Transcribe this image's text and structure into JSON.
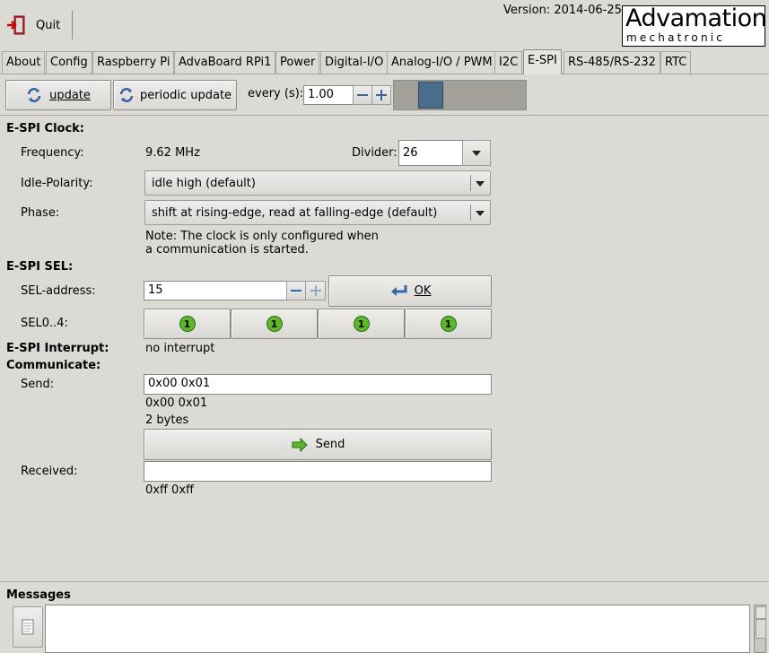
{
  "toolbar": {
    "quit_label": "Quit",
    "version": "Version: 2014-06-25"
  },
  "logo": {
    "line1": "Advamation",
    "line2": "mechatronic"
  },
  "tabs": [
    {
      "label": "About"
    },
    {
      "label": "Config"
    },
    {
      "label": "Raspberry Pi"
    },
    {
      "label": "AdvaBoard RPi1"
    },
    {
      "label": "Power"
    },
    {
      "label": "Digital-I/O"
    },
    {
      "label": "Analog-I/O / PWM"
    },
    {
      "label": "I2C"
    },
    {
      "label": "E-SPI"
    },
    {
      "label": "RS-485/RS-232"
    },
    {
      "label": "RTC"
    }
  ],
  "update_bar": {
    "update_label": "update",
    "periodic_label": "periodic update",
    "every_label": "every (s):",
    "every_value": "1.00",
    "progress_fraction": 0.22
  },
  "clock": {
    "heading": "E-SPI Clock:",
    "freq_label": "Frequency:",
    "freq_value": "9.62 MHz",
    "divider_label": "Divider:",
    "divider_value": "26",
    "idle_label": "Idle-Polarity:",
    "idle_value": "idle high (default)",
    "phase_label": "Phase:",
    "phase_value": "shift at rising-edge, read at falling-edge (default)",
    "note_line1": "Note: The clock is only configured when",
    "note_line2": "a communication is started."
  },
  "sel": {
    "heading": "E-SPI SEL:",
    "addr_label": "SEL-address:",
    "addr_value": "15",
    "ok_label": "OK",
    "sel04_label": "SEL0..4:",
    "indicators": [
      "1",
      "1",
      "1",
      "1"
    ]
  },
  "interrupt": {
    "label": "E-SPI Interrupt:",
    "value": "no interrupt"
  },
  "communicate": {
    "heading": "Communicate:",
    "send_label": "Send:",
    "send_value": "0x00 0x01",
    "parsed": "0x00 0x01",
    "byte_count": "2 bytes",
    "send_button": "Send",
    "received_label": "Received:",
    "received_value": "",
    "received_parsed": "0xff 0xff"
  },
  "messages": {
    "heading": "Messages",
    "text": ""
  },
  "colors": {
    "bg": "#dcdad5",
    "progress_block": "#4a6d8c",
    "indicator_green": "#5cb82a"
  }
}
